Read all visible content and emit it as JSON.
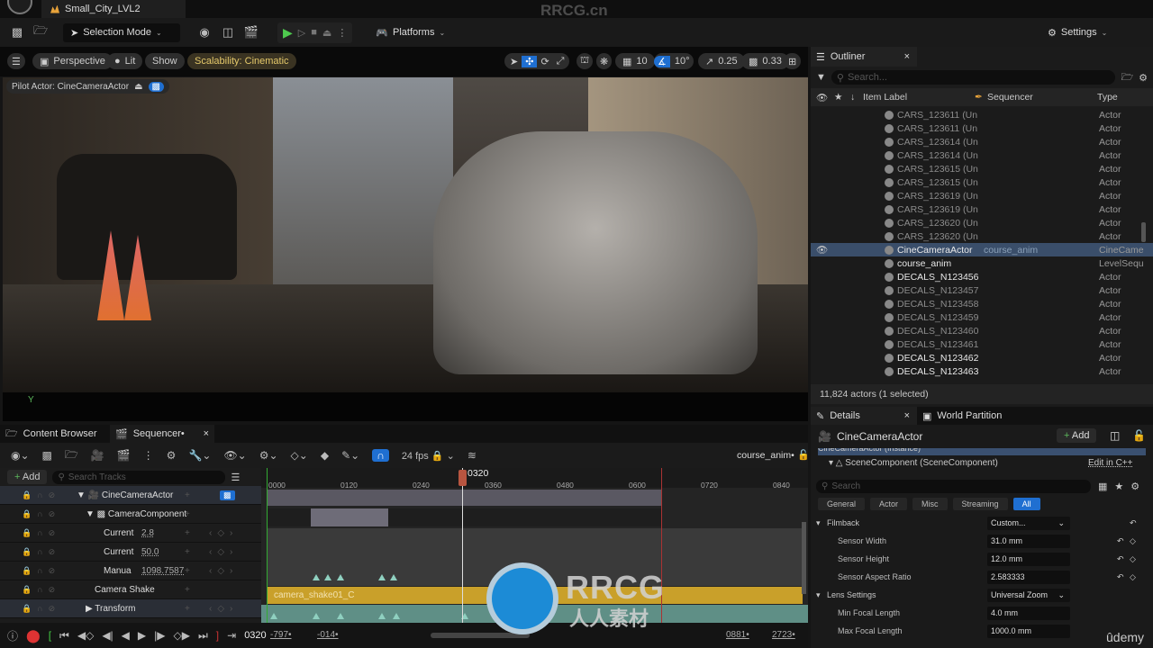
{
  "window": {
    "level_tab": "Small_City_LVL2",
    "watermark_top": "RRCG.cn"
  },
  "toolbar": {
    "selection_mode": "Selection Mode",
    "platforms": "Platforms",
    "settings": "Settings"
  },
  "viewport": {
    "menu_icon": "hamburger-icon",
    "perspective": "Perspective",
    "lit": "Lit",
    "show": "Show",
    "scalability": "Scalability: Cinematic",
    "grid_size": "10",
    "rotation_snap": "10°",
    "scale_snap": "0.25",
    "camera_speed": "0.33",
    "pilot_actor": "Pilot Actor: CineCameraActor",
    "axis_label": "Y"
  },
  "outliner": {
    "tab": "Outliner",
    "search_placeholder": "Search...",
    "columns": {
      "label": "Item Label",
      "sequencer": "Sequencer",
      "type": "Type"
    },
    "rows": [
      {
        "label": "CARS_123611 (Un",
        "type": "Actor",
        "style": "dim"
      },
      {
        "label": "CARS_123611 (Un",
        "type": "Actor",
        "style": "dim"
      },
      {
        "label": "CARS_123614 (Un",
        "type": "Actor",
        "style": "dim"
      },
      {
        "label": "CARS_123614 (Un",
        "type": "Actor",
        "style": "dim"
      },
      {
        "label": "CARS_123615 (Un",
        "type": "Actor",
        "style": "dim"
      },
      {
        "label": "CARS_123615 (Un",
        "type": "Actor",
        "style": "dim"
      },
      {
        "label": "CARS_123619 (Un",
        "type": "Actor",
        "style": "dim"
      },
      {
        "label": "CARS_123619 (Un",
        "type": "Actor",
        "style": "dim"
      },
      {
        "label": "CARS_123620 (Un",
        "type": "Actor",
        "style": "dim"
      },
      {
        "label": "CARS_123620 (Un",
        "type": "Actor",
        "style": "dim"
      },
      {
        "label": "CineCameraActor",
        "sequencer": "course_anim",
        "type": "CineCame",
        "style": "selected"
      },
      {
        "label": "course_anim",
        "type": "LevelSequ",
        "style": "bright"
      },
      {
        "label": "DECALS_N123456",
        "type": "Actor",
        "style": "bright"
      },
      {
        "label": "DECALS_N123457",
        "type": "Actor",
        "style": "dim"
      },
      {
        "label": "DECALS_N123458",
        "type": "Actor",
        "style": "dim"
      },
      {
        "label": "DECALS_N123459",
        "type": "Actor",
        "style": "dim"
      },
      {
        "label": "DECALS_N123460",
        "type": "Actor",
        "style": "dim"
      },
      {
        "label": "DECALS_N123461",
        "type": "Actor",
        "style": "dim"
      },
      {
        "label": "DECALS_N123462",
        "type": "Actor",
        "style": "bright"
      },
      {
        "label": "DECALS_N123463",
        "type": "Actor",
        "style": "bright"
      }
    ],
    "status": "11,824 actors (1 selected)"
  },
  "details": {
    "tab": "Details",
    "tab2": "World Partition",
    "actor_name": "CineCameraActor",
    "add": "Add",
    "instance": "CineCameraActor (Instance)",
    "component": "SceneComponent (SceneComponent)",
    "edit_cpp": "Edit in C++",
    "search_placeholder": "Search",
    "categories": [
      "General",
      "Actor",
      "Misc",
      "Streaming",
      "All"
    ],
    "filmback": {
      "label": "Filmback",
      "preset": "Custom..."
    },
    "props": [
      {
        "name": "Sensor Width",
        "value": "31.0 mm"
      },
      {
        "name": "Sensor Height",
        "value": "12.0 mm"
      },
      {
        "name": "Sensor Aspect Ratio",
        "value": "2.583333"
      }
    ],
    "lens": {
      "label": "Lens Settings",
      "preset": "Universal Zoom"
    },
    "lens_props": [
      {
        "name": "Min Focal Length",
        "value": "4.0 mm"
      },
      {
        "name": "Max Focal Length",
        "value": "1000.0 mm"
      }
    ],
    "udemy": "ûdemy"
  },
  "sequencer": {
    "tab_cb": "Content Browser",
    "tab_seq": "Sequencer•",
    "fps": "24 fps",
    "sequence_name": "course_anim•",
    "add": "Add",
    "search_placeholder": "Search Tracks",
    "playhead": "0320",
    "ruler": [
      "0000",
      "0120",
      "0240",
      "0360",
      "0480",
      "0600",
      "0720",
      "0840"
    ],
    "tracks": [
      {
        "name": "CineCameraActor",
        "indent": 1
      },
      {
        "name": "CameraComponent",
        "indent": 2
      },
      {
        "name": "Current",
        "value": "2.8"
      },
      {
        "name": "Current",
        "value": "50.0"
      },
      {
        "name": "Manua",
        "value": "1098.7587"
      },
      {
        "name": "Camera Shake"
      },
      {
        "name": "Transform"
      }
    ],
    "shake_section": "camera_shake01_C",
    "transport": {
      "frame": "0320",
      "start": "-797•",
      "in": "-014•",
      "out": "0881•",
      "end": "2723•"
    }
  },
  "watermark": {
    "brand": "RRCG",
    "sub": "人人素材"
  }
}
